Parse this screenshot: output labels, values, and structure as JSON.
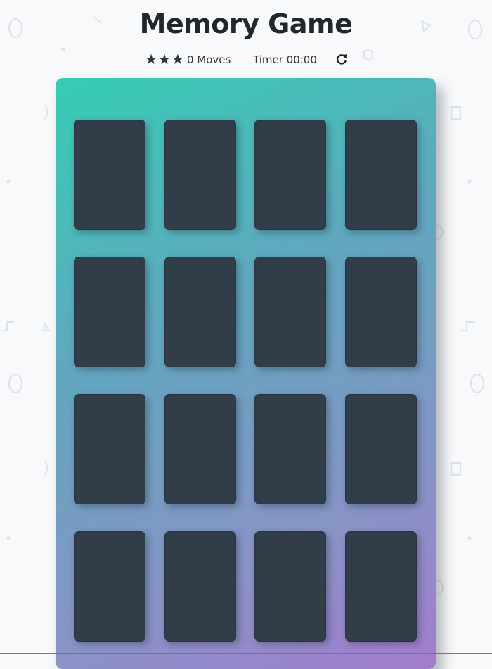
{
  "page": {
    "title": "Memory Game"
  },
  "score_panel": {
    "stars": [
      "★",
      "★",
      "★"
    ],
    "star_rating": 3,
    "moves_label": "0 Moves",
    "timer_label": "Timer 00:00",
    "restart_icon": "restart-icon"
  },
  "deck": {
    "rows": 4,
    "columns": 4,
    "cards": [
      {
        "state": "face-down"
      },
      {
        "state": "face-down"
      },
      {
        "state": "face-down"
      },
      {
        "state": "face-down"
      },
      {
        "state": "face-down"
      },
      {
        "state": "face-down"
      },
      {
        "state": "face-down"
      },
      {
        "state": "face-down"
      },
      {
        "state": "face-down"
      },
      {
        "state": "face-down"
      },
      {
        "state": "face-down"
      },
      {
        "state": "face-down"
      },
      {
        "state": "face-down"
      },
      {
        "state": "face-down"
      },
      {
        "state": "face-down"
      },
      {
        "state": "face-down"
      }
    ]
  },
  "colors": {
    "background": "#f8f9fb",
    "card_back": "#323d4a",
    "deck_gradient_start": "#35cdb4",
    "deck_gradient_end": "#a37ccf",
    "title": "#22272d"
  }
}
